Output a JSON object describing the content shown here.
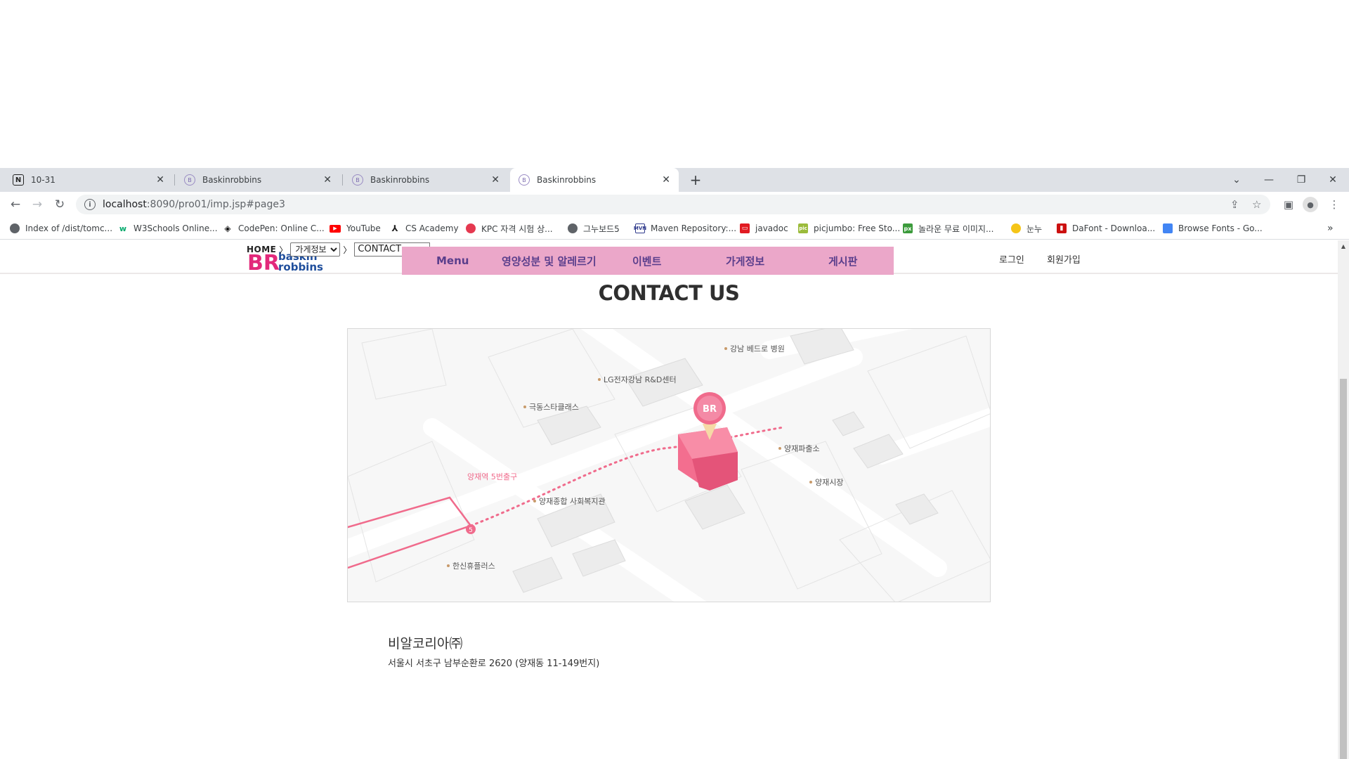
{
  "browser": {
    "tabs": [
      {
        "title": "10-31",
        "favicon": "notion-icon"
      },
      {
        "title": "Baskinrobbins",
        "favicon": "br-icon"
      },
      {
        "title": "Baskinrobbins",
        "favicon": "br-icon"
      },
      {
        "title": "Baskinrobbins",
        "favicon": "br-icon",
        "active": true
      }
    ],
    "new_tab": "+",
    "url_host": "localhost",
    "url_path": ":8090/pro01/imp.jsp#page3",
    "bookmarks": [
      {
        "label": "Index of /dist/tomc...",
        "icon": "globe-icon"
      },
      {
        "label": "W3Schools Online...",
        "icon": "w3schools-icon"
      },
      {
        "label": "CodePen: Online C...",
        "icon": "codepen-icon"
      },
      {
        "label": "YouTube",
        "icon": "youtube-icon"
      },
      {
        "label": "CS Academy",
        "icon": "csacademy-icon"
      },
      {
        "label": "KPC 자격 시험 상...",
        "icon": "kpc-icon"
      },
      {
        "label": "그누보드5",
        "icon": "globe-icon"
      },
      {
        "label": "Maven Repository:...",
        "icon": "maven-icon"
      },
      {
        "label": "javadoc",
        "icon": "javadoc-icon"
      },
      {
        "label": "picjumbo: Free Sto...",
        "icon": "picjumbo-icon"
      },
      {
        "label": "놀라운 무료 이미지...",
        "icon": "pixabay-icon"
      },
      {
        "label": "눈누",
        "icon": "noonnu-icon"
      },
      {
        "label": "DaFont - Downloa...",
        "icon": "dafont-icon"
      },
      {
        "label": "Browse Fonts - Go...",
        "icon": "googlefonts-icon"
      }
    ],
    "more_bookmarks": "»"
  },
  "site": {
    "breadcrumb": {
      "home": "HOME",
      "selected": "가게정보",
      "current": "CONTACT"
    },
    "logo_text_top": "baskin",
    "logo_text_bottom": "robbins",
    "logo_mark": "BR",
    "nav": [
      "Menu",
      "영양성분 및 알레르기",
      "이벤트",
      "가게정보",
      "게시판"
    ],
    "util": {
      "login": "로그인",
      "signup": "회원가입"
    },
    "brand_color": "#eba7c9",
    "nav_text_color": "#5a3e8c"
  },
  "contact": {
    "title": "CONTACT US",
    "map_labels": {
      "hospital": "강남 베드로 병원",
      "lg": "LG전자강남 R&D센터",
      "star": "극동스타클래스",
      "police": "양재파출소",
      "station_exit": "양재역 5번출구",
      "exit_number": "5",
      "welfare": "양재종합 사회복지관",
      "market": "양재시장",
      "hanshin": "한신휴플러스",
      "pin": "BR"
    },
    "company": "비알코리아㈜",
    "address": "서울시 서초구 남부순환로 2620 (양재동 11-149번지)"
  }
}
